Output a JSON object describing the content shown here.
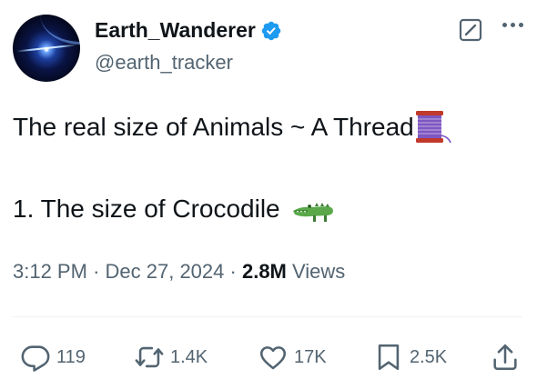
{
  "author": {
    "display_name": "Earth_Wanderer",
    "handle": "@earth_tracker",
    "verified_icon": "verified-badge-icon",
    "verified_color": "#1d9bf0"
  },
  "tweet": {
    "line1": "The real size of Animals ~ A Thread",
    "line1_emoji": "spool-of-thread-emoji",
    "line2": "1. The size of Crocodile",
    "line2_emoji": "crocodile-emoji"
  },
  "meta": {
    "time": "3:12 PM",
    "separator": "·",
    "date": "Dec 27, 2024",
    "views_count": "2.8M",
    "views_label": "Views"
  },
  "actions": {
    "reply_count": "119",
    "repost_count": "1.4K",
    "like_count": "17K",
    "bookmark_count": "2.5K"
  },
  "icons": {
    "grok": "grok-icon",
    "more": "more-icon",
    "reply": "reply-icon",
    "repost": "repost-icon",
    "like": "like-icon",
    "bookmark": "bookmark-icon",
    "share": "share-icon"
  },
  "colors": {
    "text_primary": "#0f1419",
    "text_secondary": "#536471",
    "divider": "#eff3f4"
  }
}
